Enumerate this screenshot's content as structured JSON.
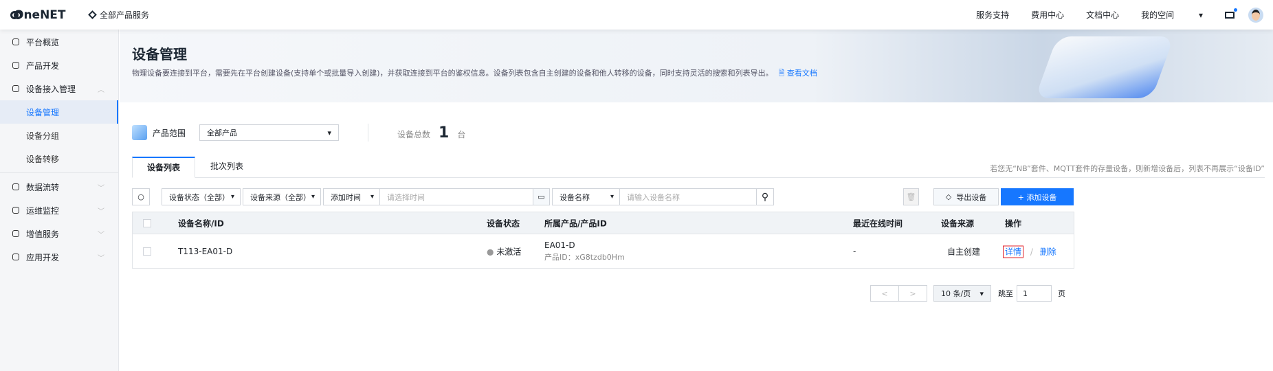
{
  "header": {
    "logo": "OneNET",
    "all_services": "全部产品服务",
    "nav": [
      "服务支持",
      "费用中心",
      "文档中心",
      "我的空间"
    ]
  },
  "sidebar": {
    "items": [
      {
        "label": "平台概览"
      },
      {
        "label": "产品开发"
      },
      {
        "label": "设备接入管理"
      },
      {
        "label": "设备管理"
      },
      {
        "label": "设备分组"
      },
      {
        "label": "设备转移"
      },
      {
        "label": "数据流转"
      },
      {
        "label": "运维监控"
      },
      {
        "label": "增值服务"
      },
      {
        "label": "应用开发"
      }
    ]
  },
  "page": {
    "title": "设备管理",
    "description": "物理设备要连接到平台，需要先在平台创建设备(支持单个或批量导入创建)，并获取连接到平台的鉴权信息。设备列表包含自主创建的设备和他人转移的设备，同时支持灵活的搜索和列表导出。",
    "doc_link": "查看文档"
  },
  "range": {
    "label": "产品范围",
    "selected": "全部产品",
    "total_label": "设备总数",
    "total": "1",
    "unit": "台"
  },
  "tabs": [
    "设备列表",
    "批次列表"
  ],
  "tip": "若您无“NB”套件、MQTT套件的存量设备，则新增设备后，列表不再展示“设备ID”",
  "toolbar": {
    "status": "设备状态（全部）",
    "source": "设备来源（全部）",
    "time": "添加时间",
    "time_placeholder": "请选择时间",
    "name_field": "设备名称",
    "name_placeholder": "请输入设备名称",
    "export": "导出设备",
    "add": "+  添加设备"
  },
  "table": {
    "headers": [
      "设备名称/ID",
      "设备状态",
      "所属产品/产品ID",
      "最近在线时间",
      "设备来源",
      "操作"
    ],
    "rows": [
      {
        "name": "T113-EA01-D",
        "status": "未激活",
        "product": "EA01-D",
        "product_id": "产品ID：xG8tzdb0Hm",
        "last_online": "-",
        "source": "自主创建",
        "detail": "详情",
        "sep": "/",
        "delete": "删除"
      }
    ]
  },
  "pagination": {
    "prev": "<",
    "next": ">",
    "page_size": "10 条/页",
    "jump": "跳至",
    "page": "1",
    "page_unit": "页"
  }
}
